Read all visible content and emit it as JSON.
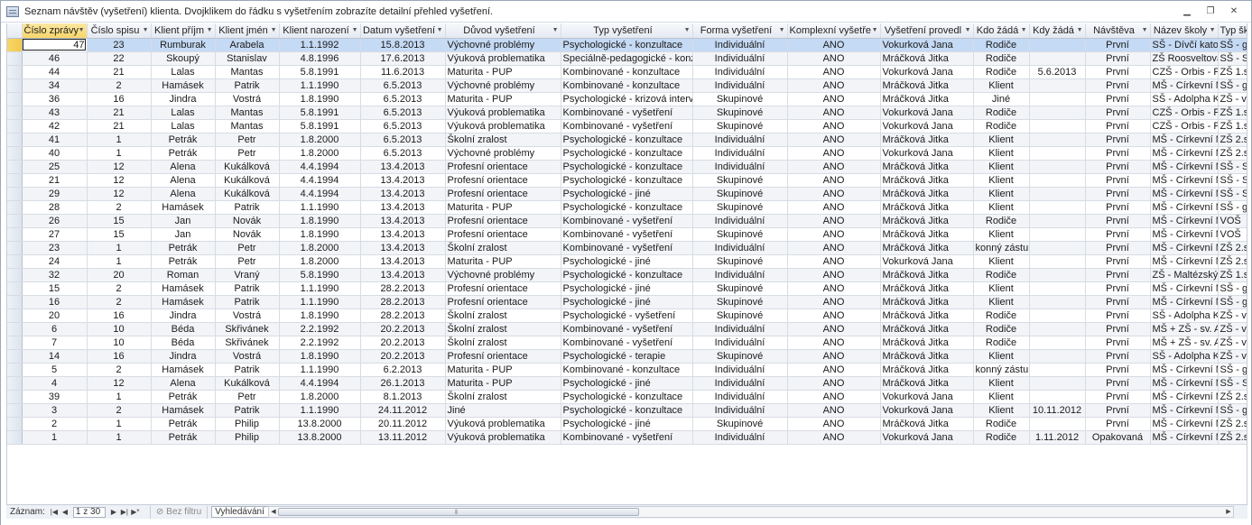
{
  "window": {
    "title": "Seznam návštěv (vyšetření) klienta. Dvojklikem do řádku s vyšetřením zobrazíte detailní přehled vyšetření.",
    "minimize_icon": "minimize-icon",
    "restore_icon": "restore-icon",
    "close_icon": "close-icon"
  },
  "columns": [
    "Číslo zprávy",
    "Číslo spisu",
    "Klient příjm",
    "Klient jmén",
    "Klient narození",
    "Datum vyšetření",
    "Důvod vyšetření",
    "Typ vyšetření",
    "Forma vyšetření",
    "Komplexní vyšetře",
    "Vyšetření provedl",
    "Kdo žádá",
    "Kdy žádá",
    "Návštěva",
    "Název školy",
    "Typ šk"
  ],
  "rows": [
    [
      "47",
      "23",
      "Rumburak",
      "Arabela",
      "1.1.1992",
      "15.8.2013",
      "Výchovné problémy",
      "Psychologické - konzultace",
      "Individuální",
      "ANO",
      "Vokurková Jana",
      "Rodiče",
      "",
      "První",
      "SŠ - Dívčí katolic",
      "SŠ - gy"
    ],
    [
      "46",
      "22",
      "Skoupý",
      "Stanislav",
      "4.8.1996",
      "17.6.2013",
      "Výuková problematika",
      "Speciálně-pedagogické - konzu",
      "Individuální",
      "ANO",
      "Mráčková Jitka",
      "Rodiče",
      "",
      "První",
      "ZŠ Roosveltova",
      "SŠ - SO"
    ],
    [
      "44",
      "21",
      "Lalas",
      "Mantas",
      "5.8.1991",
      "11.6.2013",
      "Maturita - PUP",
      "Kombinované - konzultace",
      "Individuální",
      "ANO",
      "Vokurková Jana",
      "Rodiče",
      "5.6.2013",
      "První",
      "CZŠ - Orbis - Pic",
      "ZŠ 1.st"
    ],
    [
      "34",
      "2",
      "Hamásek",
      "Patrik",
      "1.1.1990",
      "6.5.2013",
      "Výchovné problémy",
      "Kombinované - konzultace",
      "Individuální",
      "ANO",
      "Mráčková Jitka",
      "Klient",
      "",
      "První",
      "MŠ - Církevní M",
      "SŠ - gy"
    ],
    [
      "36",
      "16",
      "Jindra",
      "Vostrá",
      "1.8.1990",
      "6.5.2013",
      "Maturita - PUP",
      "Psychologické - krizová interve",
      "Skupinové",
      "ANO",
      "Mráčková Jitka",
      "Jiné",
      "",
      "První",
      "SŠ - Adolpha Ko",
      "ZŠ - vic"
    ],
    [
      "43",
      "21",
      "Lalas",
      "Mantas",
      "5.8.1991",
      "6.5.2013",
      "Výuková problematika",
      "Kombinované - vyšetření",
      "Skupinové",
      "ANO",
      "Vokurková Jana",
      "Rodiče",
      "",
      "První",
      "CZŠ - Orbis - Pic",
      "ZŠ 1.st"
    ],
    [
      "42",
      "21",
      "Lalas",
      "Mantas",
      "5.8.1991",
      "6.5.2013",
      "Výuková problematika",
      "Kombinované - vyšetření",
      "Skupinové",
      "ANO",
      "Vokurková Jana",
      "Rodiče",
      "",
      "První",
      "CZŠ - Orbis - Pic",
      "ZŠ 1.st"
    ],
    [
      "41",
      "1",
      "Petrák",
      "Petr",
      "1.8.2000",
      "6.5.2013",
      "Školní zralost",
      "Psychologické - konzultace",
      "Individuální",
      "ANO",
      "Mráčková Jitka",
      "Klient",
      "",
      "První",
      "MŠ - Církevní M",
      "ZŠ 2.st"
    ],
    [
      "40",
      "1",
      "Petrák",
      "Petr",
      "1.8.2000",
      "6.5.2013",
      "Výchovné problémy",
      "Psychologické - konzultace",
      "Individuální",
      "ANO",
      "Vokurková Jana",
      "Klient",
      "",
      "První",
      "MŠ - Církevní M",
      "ZŠ 2.st"
    ],
    [
      "25",
      "12",
      "Alena",
      "Kukálková",
      "4.4.1994",
      "13.4.2013",
      "Profesní orientace",
      "Psychologické - konzultace",
      "Individuální",
      "ANO",
      "Mráčková Jitka",
      "Klient",
      "",
      "První",
      "MŠ - Církevní M",
      "SŠ - SO"
    ],
    [
      "21",
      "12",
      "Alena",
      "Kukálková",
      "4.4.1994",
      "13.4.2013",
      "Profesní orientace",
      "Psychologické - konzultace",
      "Skupinové",
      "ANO",
      "Mráčková Jitka",
      "Klient",
      "",
      "První",
      "MŠ - Církevní M",
      "SŠ - SO"
    ],
    [
      "29",
      "12",
      "Alena",
      "Kukálková",
      "4.4.1994",
      "13.4.2013",
      "Profesní orientace",
      "Psychologické - jiné",
      "Skupinové",
      "ANO",
      "Mráčková Jitka",
      "Klient",
      "",
      "První",
      "MŠ - Církevní M",
      "SŠ - SO"
    ],
    [
      "28",
      "2",
      "Hamásek",
      "Patrik",
      "1.1.1990",
      "13.4.2013",
      "Maturita - PUP",
      "Psychologické - konzultace",
      "Skupinové",
      "ANO",
      "Mráčková Jitka",
      "Klient",
      "",
      "První",
      "MŠ - Církevní M",
      "SŠ - gy"
    ],
    [
      "26",
      "15",
      "Jan",
      "Novák",
      "1.8.1990",
      "13.4.2013",
      "Profesní orientace",
      "Kombinované - vyšetření",
      "Individuální",
      "ANO",
      "Mráčková Jitka",
      "Rodiče",
      "",
      "První",
      "MŠ - Církevní M",
      "VOŠ"
    ],
    [
      "27",
      "15",
      "Jan",
      "Novák",
      "1.8.1990",
      "13.4.2013",
      "Profesní orientace",
      "Kombinované - vyšetření",
      "Skupinové",
      "ANO",
      "Mráčková Jitka",
      "Klient",
      "",
      "První",
      "MŠ - Církevní M",
      "VOŠ"
    ],
    [
      "23",
      "1",
      "Petrák",
      "Petr",
      "1.8.2000",
      "13.4.2013",
      "Školní zralost",
      "Kombinované - vyšetření",
      "Individuální",
      "ANO",
      "Mráčková Jitka",
      "konný zástup",
      "",
      "První",
      "MŠ - Církevní M",
      "ZŠ 2.st"
    ],
    [
      "24",
      "1",
      "Petrák",
      "Petr",
      "1.8.2000",
      "13.4.2013",
      "Maturita - PUP",
      "Psychologické - jiné",
      "Skupinové",
      "ANO",
      "Vokurková Jana",
      "Klient",
      "",
      "První",
      "MŠ - Církevní M",
      "ZŠ 2.st"
    ],
    [
      "32",
      "20",
      "Roman",
      "Vraný",
      "5.8.1990",
      "13.4.2013",
      "Výchovné problémy",
      "Psychologické - konzultace",
      "Individuální",
      "ANO",
      "Mráčková Jitka",
      "Rodiče",
      "",
      "První",
      "ZŠ - Maltézských",
      "ZŠ 1.st"
    ],
    [
      "15",
      "2",
      "Hamásek",
      "Patrik",
      "1.1.1990",
      "28.2.2013",
      "Profesní orientace",
      "Psychologické - jiné",
      "Skupinové",
      "ANO",
      "Mráčková Jitka",
      "Klient",
      "",
      "První",
      "MŠ - Církevní M",
      "SŠ - gy"
    ],
    [
      "16",
      "2",
      "Hamásek",
      "Patrik",
      "1.1.1990",
      "28.2.2013",
      "Profesní orientace",
      "Psychologické - jiné",
      "Skupinové",
      "ANO",
      "Mráčková Jitka",
      "Klient",
      "",
      "První",
      "MŠ - Církevní M",
      "SŠ - gy"
    ],
    [
      "20",
      "16",
      "Jindra",
      "Vostrá",
      "1.8.1990",
      "28.2.2013",
      "Školní zralost",
      "Psychologické - vyšetření",
      "Skupinové",
      "ANO",
      "Mráčková Jitka",
      "Rodiče",
      "",
      "První",
      "SŠ - Adolpha Ko",
      "ZŠ - vic"
    ],
    [
      "6",
      "10",
      "Béda",
      "Skřivánek",
      "2.2.1992",
      "20.2.2013",
      "Školní zralost",
      "Kombinované - vyšetření",
      "Individuální",
      "ANO",
      "Mráčková Jitka",
      "Rodiče",
      "",
      "První",
      "MŠ + ZŠ - sv. Aug",
      "ZŠ - vic"
    ],
    [
      "7",
      "10",
      "Béda",
      "Skřivánek",
      "2.2.1992",
      "20.2.2013",
      "Školní zralost",
      "Kombinované - vyšetření",
      "Individuální",
      "ANO",
      "Mráčková Jitka",
      "Rodiče",
      "",
      "První",
      "MŠ + ZŠ - sv. Aug",
      "ZŠ - vic"
    ],
    [
      "14",
      "16",
      "Jindra",
      "Vostrá",
      "1.8.1990",
      "20.2.2013",
      "Profesní orientace",
      "Psychologické - terapie",
      "Skupinové",
      "ANO",
      "Mráčková Jitka",
      "Klient",
      "",
      "První",
      "SŠ - Adolpha Ko",
      "ZŠ - vic"
    ],
    [
      "5",
      "2",
      "Hamásek",
      "Patrik",
      "1.1.1990",
      "6.2.2013",
      "Maturita - PUP",
      "Kombinované - konzultace",
      "Individuální",
      "ANO",
      "Mráčková Jitka",
      "konný zástup",
      "",
      "První",
      "MŠ - Církevní M",
      "SŠ - gy"
    ],
    [
      "4",
      "12",
      "Alena",
      "Kukálková",
      "4.4.1994",
      "26.1.2013",
      "Maturita - PUP",
      "Psychologické - jiné",
      "Individuální",
      "ANO",
      "Mráčková Jitka",
      "Klient",
      "",
      "První",
      "MŠ - Církevní M",
      "SŠ - SO"
    ],
    [
      "39",
      "1",
      "Petrák",
      "Petr",
      "1.8.2000",
      "8.1.2013",
      "Školní zralost",
      "Psychologické - konzultace",
      "Individuální",
      "ANO",
      "Vokurková Jana",
      "Klient",
      "",
      "První",
      "MŠ - Církevní M",
      "ZŠ 2.st"
    ],
    [
      "3",
      "2",
      "Hamásek",
      "Patrik",
      "1.1.1990",
      "24.11.2012",
      "Jiné",
      "Psychologické - konzultace",
      "Individuální",
      "ANO",
      "Vokurková Jana",
      "Klient",
      "10.11.2012",
      "První",
      "MŠ - Církevní M",
      "SŠ - gy"
    ],
    [
      "2",
      "1",
      "Petrák",
      "Philip",
      "13.8.2000",
      "20.11.2012",
      "Výuková problematika",
      "Psychologické - jiné",
      "Skupinové",
      "ANO",
      "Mráčková Jitka",
      "Rodiče",
      "",
      "První",
      "MŠ - Církevní M",
      "ZŠ 2.st"
    ],
    [
      "1",
      "1",
      "Petrák",
      "Philip",
      "13.8.2000",
      "13.11.2012",
      "Výuková problematika",
      "Kombinované - vyšetření",
      "Individuální",
      "ANO",
      "Vokurková Jana",
      "Rodiče",
      "1.11.2012",
      "Opakovaná",
      "MŠ - Církevní M",
      "ZŠ 2.st"
    ]
  ],
  "status": {
    "record_label": "Záznam:",
    "record_position": "1 z 30",
    "filter_label": "Bez filtru",
    "search_label": "Vyhledávání"
  }
}
